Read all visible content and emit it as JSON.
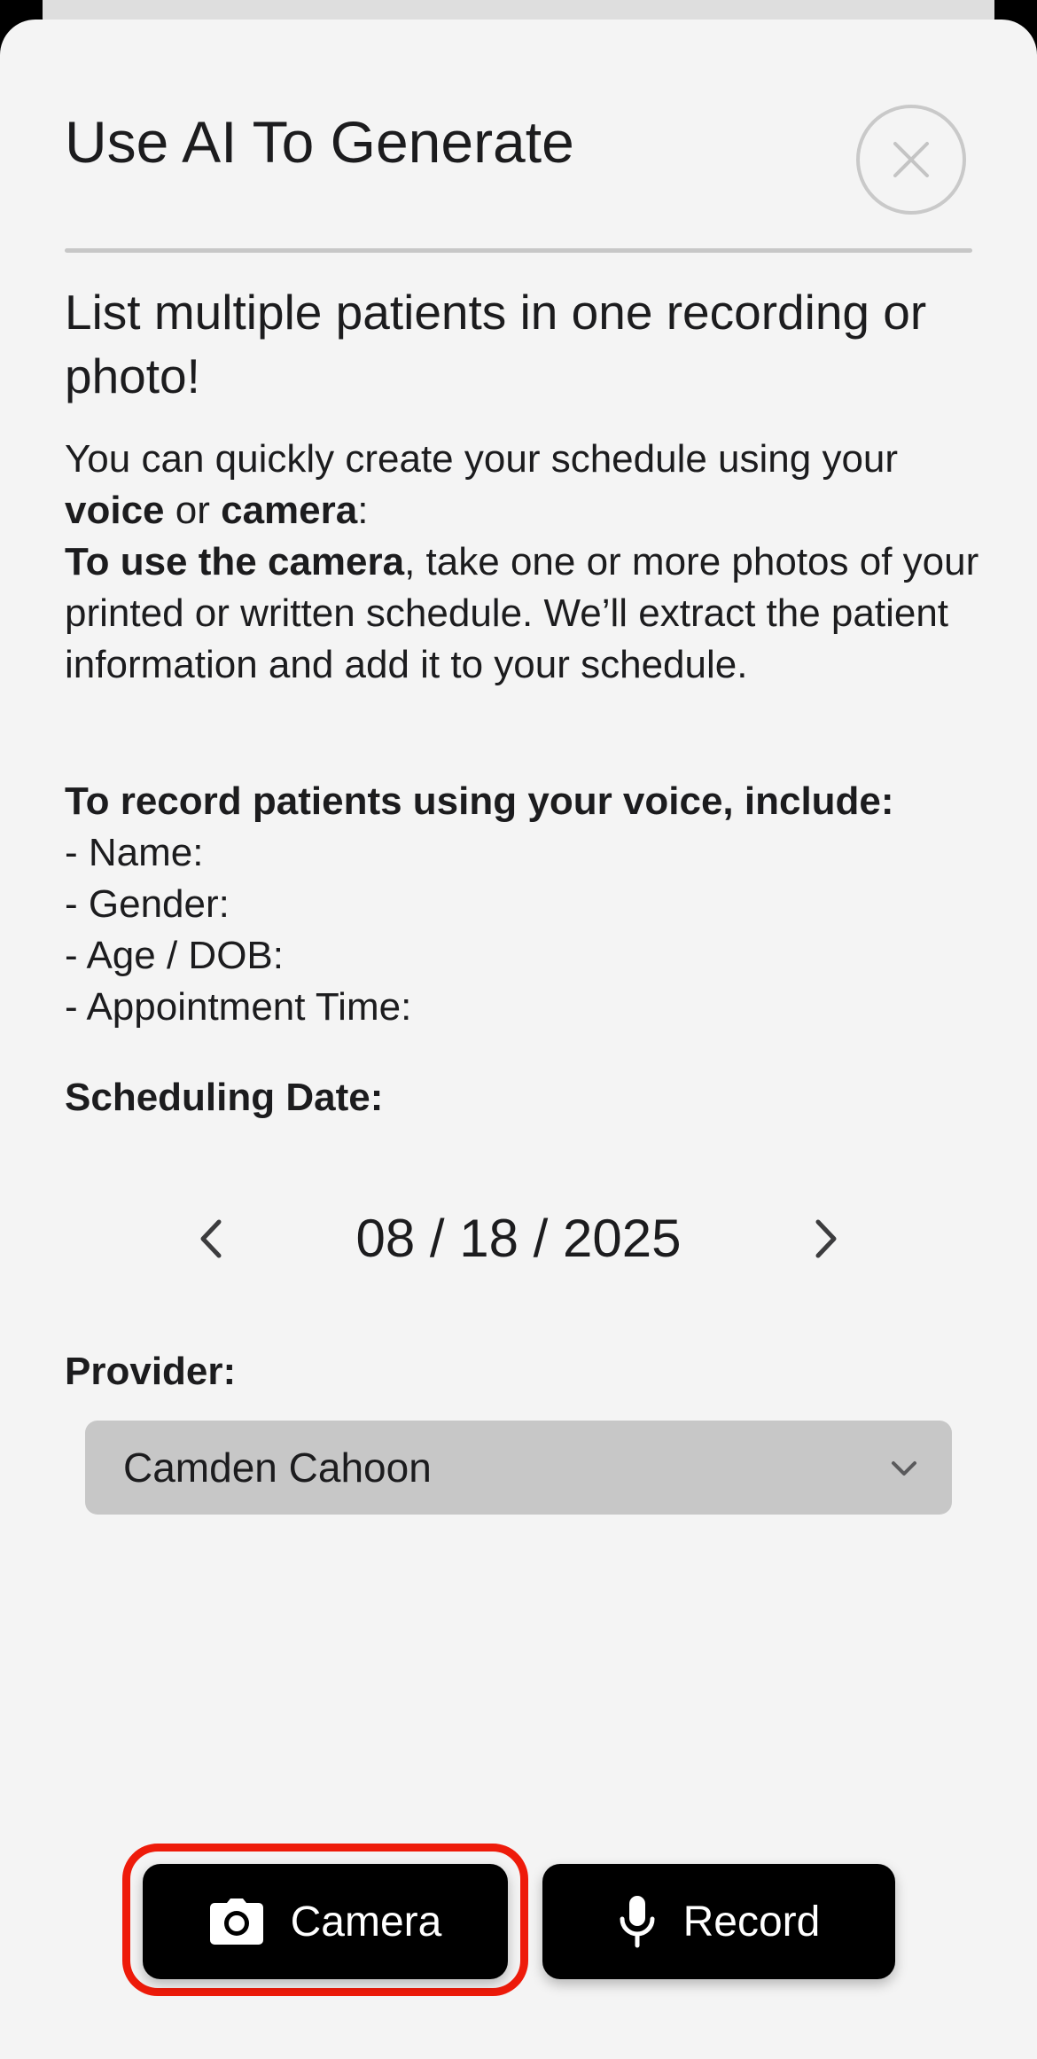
{
  "modal": {
    "title": "Use AI To Generate",
    "subtitle": "List multiple patients in one recording or photo!"
  },
  "intro": {
    "part1": "You can quickly create your schedule using your ",
    "voice": "voice",
    "or": " or ",
    "camera": "camera",
    "colon": ":",
    "camera_heading": "To use the camera",
    "camera_text": ", take one or more photos of your printed or written schedule. We’ll extract the patient information and add it to your schedule."
  },
  "voice_instructions": {
    "heading": "To record patients using your voice, include:",
    "items": [
      "- Name:",
      "- Gender:",
      "- Age / DOB:",
      "- Appointment Time:"
    ]
  },
  "scheduling": {
    "label": "Scheduling Date:",
    "date": "08 / 18 / 2025"
  },
  "provider": {
    "label": "Provider:",
    "selected": "Camden Cahoon"
  },
  "actions": {
    "camera_label": "Camera",
    "record_label": "Record"
  },
  "icons": {
    "close": "close-icon",
    "prev": "chevron-left-icon",
    "next": "chevron-right-icon",
    "dropdown": "chevron-down-icon",
    "camera": "camera-icon",
    "microphone": "microphone-icon"
  },
  "colors": {
    "sheet_background": "#f4f4f4",
    "button_background": "#000000",
    "highlight": "#ee1b0a",
    "select_background": "#c7c7c7"
  }
}
